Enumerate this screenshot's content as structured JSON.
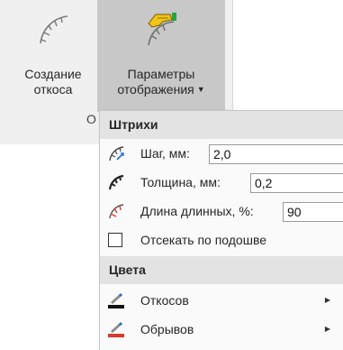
{
  "ribbon": {
    "create_slope": {
      "line1": "Создание",
      "line2": "откоса"
    },
    "display_params": {
      "line1": "Параметры",
      "line2": "отображения",
      "caret": "▼"
    },
    "group_label": "О"
  },
  "menu": {
    "hatches": {
      "header": "Штрихи",
      "step": {
        "label": "Шаг, мм:",
        "value": "2,0"
      },
      "thickness": {
        "label": "Толщина, мм:",
        "value": "0,2"
      },
      "long_length": {
        "label": "Длина длинных, %:",
        "value": "90"
      },
      "cut_by_base": {
        "label": "Отсекать по подошве",
        "checked": false
      }
    },
    "colors": {
      "header": "Цвета",
      "slopes": {
        "label": "Откосов",
        "arrow": "▶"
      },
      "cliffs": {
        "label": "Обрывов",
        "arrow": "▶"
      }
    }
  },
  "theme": {
    "ribbon_bg": "#f0f0f0",
    "active_button_bg": "#c8c8c8",
    "menu_bg": "#fafafa",
    "section_bg": "#e3e3e3",
    "accent_blue": "#1f6fd1",
    "accent_red": "#d9392f",
    "accent_yellow": "#f0c419",
    "accent_green": "#1fa83c"
  }
}
